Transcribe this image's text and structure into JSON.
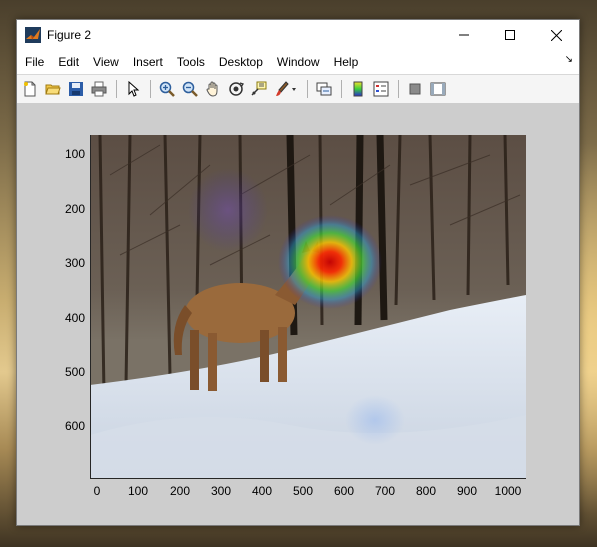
{
  "window": {
    "title": "Figure 2",
    "minimize_glyph": "—",
    "maximize_glyph": "☐",
    "close_glyph": "✕"
  },
  "menu": {
    "items": [
      {
        "label": "File"
      },
      {
        "label": "Edit"
      },
      {
        "label": "View"
      },
      {
        "label": "Insert"
      },
      {
        "label": "Tools"
      },
      {
        "label": "Desktop"
      },
      {
        "label": "Window"
      },
      {
        "label": "Help"
      }
    ],
    "dock_glyph": "↘"
  },
  "toolbar": {
    "icons": [
      "new-figure-icon",
      "open-file-icon",
      "save-icon",
      "print-icon",
      "pointer-icon",
      "zoom-in-icon",
      "zoom-out-icon",
      "pan-icon",
      "rotate-3d-icon",
      "data-cursor-icon",
      "brush-icon",
      "link-plot-icon",
      "colorbar-icon",
      "legend-icon",
      "hide-plot-tools-icon",
      "show-plot-tools-icon"
    ]
  },
  "colors": {
    "figure_bg": "#cdcdcd",
    "axes_line": "#262626",
    "heatmap_peak": "#d40000"
  },
  "axes": {
    "yticks": [
      "100",
      "200",
      "300",
      "400",
      "500",
      "600"
    ],
    "xticks": [
      "0",
      "100",
      "200",
      "300",
      "400",
      "500",
      "600",
      "700",
      "800",
      "900",
      "1000"
    ]
  }
}
